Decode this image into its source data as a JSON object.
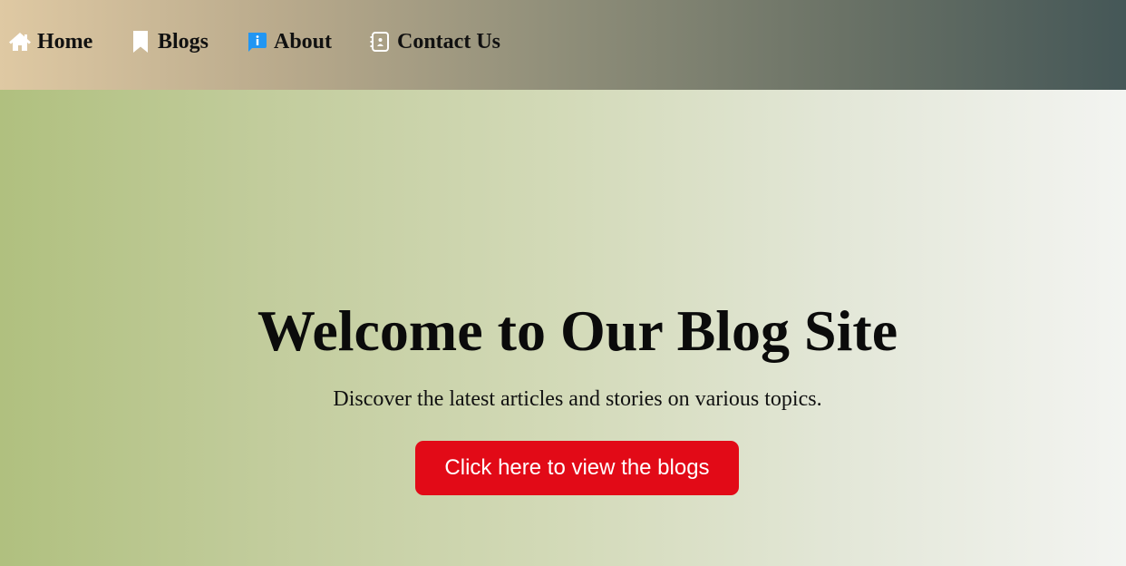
{
  "nav": {
    "items": [
      {
        "label": "Home",
        "icon": "home-icon"
      },
      {
        "label": "Blogs",
        "icon": "bookmark-icon"
      },
      {
        "label": "About",
        "icon": "info-icon"
      },
      {
        "label": "Contact Us",
        "icon": "contact-book-icon"
      }
    ]
  },
  "hero": {
    "title": "Welcome to Our Blog Site",
    "subtitle": "Discover the latest articles and stories on various topics.",
    "button_label": "Click here to view the blogs"
  },
  "colors": {
    "button_bg": "#e20a17",
    "about_icon": "#2196f3",
    "nav_gradient_start": "#dfc9a3",
    "nav_gradient_end": "#455757",
    "hero_gradient_start": "#b0c07f",
    "hero_gradient_end": "#f3f4f1"
  }
}
